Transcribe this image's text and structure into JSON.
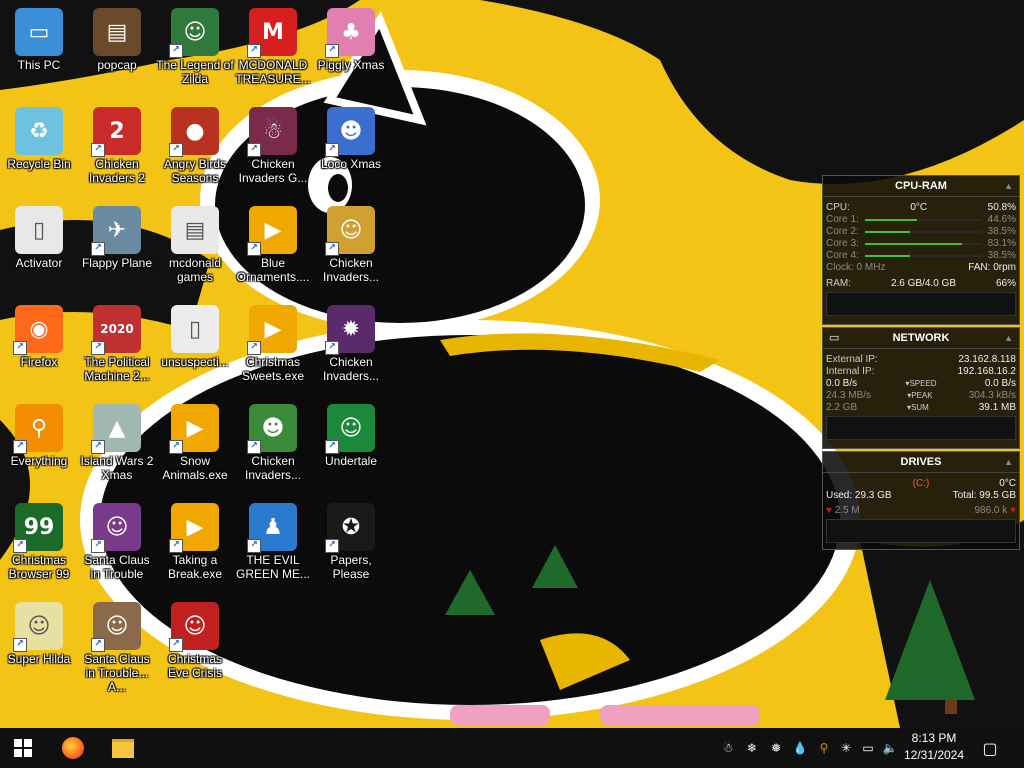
{
  "desktop": {
    "icons": [
      {
        "label": "This PC",
        "icon": "computer-icon",
        "color": "#3a8fd8",
        "glyph": "▭",
        "shortcut": false
      },
      {
        "label": "popcap",
        "icon": "folder-icon",
        "color": "#6b4a2a",
        "glyph": "▤",
        "shortcut": false
      },
      {
        "label": "The Legend of Zilda",
        "icon": "game-zilda-icon",
        "color": "#2f7a3a",
        "glyph": "☺",
        "shortcut": true
      },
      {
        "label": "MCDONALD TREASURE...",
        "icon": "mcdonalds-icon",
        "color": "#d71f1f",
        "glyph": "M",
        "shortcut": true
      },
      {
        "label": "Piggly Xmas",
        "icon": "piggly-icon",
        "color": "#e07fb0",
        "glyph": "♣",
        "shortcut": true
      },
      {
        "label": "Recycle Bin",
        "icon": "recycle-bin-icon",
        "color": "#6fc1e0",
        "glyph": "♻",
        "shortcut": false
      },
      {
        "label": "Chicken Invaders 2",
        "icon": "chicken-invaders-icon",
        "color": "#c92a2a",
        "glyph": "2",
        "shortcut": true
      },
      {
        "label": "Angry Birds Seasons",
        "icon": "angry-birds-icon",
        "color": "#b8321f",
        "glyph": "●",
        "shortcut": true
      },
      {
        "label": "Chicken Invaders G...",
        "icon": "chicken-invaders-icon",
        "color": "#7a2a4a",
        "glyph": "☃",
        "shortcut": true
      },
      {
        "label": "Loco Xmas",
        "icon": "loco-icon",
        "color": "#3a6fd0",
        "glyph": "☻",
        "shortcut": true
      },
      {
        "label": "Activator",
        "icon": "file-icon",
        "color": "#e8e8e8",
        "glyph": "▯",
        "shortcut": false
      },
      {
        "label": "Flappy Plane",
        "icon": "flappy-icon",
        "color": "#6a8aa0",
        "glyph": "✈",
        "shortcut": true
      },
      {
        "label": "mcdonald games",
        "icon": "folder-icon",
        "color": "#e9e9e9",
        "glyph": "▤",
        "shortcut": false
      },
      {
        "label": "Blue Ornaments....",
        "icon": "exe-icon",
        "color": "#f0a800",
        "glyph": "▶",
        "shortcut": true
      },
      {
        "label": "Chicken Invaders...",
        "icon": "chicken-invaders-icon",
        "color": "#d0a030",
        "glyph": "☺",
        "shortcut": true
      },
      {
        "label": "Firefox",
        "icon": "firefox-icon",
        "color": "#ff6a1a",
        "glyph": "◉",
        "shortcut": true
      },
      {
        "label": "The Political Machine 2...",
        "icon": "political-icon",
        "color": "#c03030",
        "glyph": "2020",
        "shortcut": true
      },
      {
        "label": "unsuspecti...",
        "icon": "file-icon",
        "color": "#ececec",
        "glyph": "▯",
        "shortcut": false
      },
      {
        "label": "Christmas Sweets.exe",
        "icon": "exe-icon",
        "color": "#f0a800",
        "glyph": "▶",
        "shortcut": true
      },
      {
        "label": "Chicken Invaders...",
        "icon": "chicken-invaders-icon",
        "color": "#5a2a6a",
        "glyph": "✹",
        "shortcut": true
      },
      {
        "label": "Everything",
        "icon": "search-icon",
        "color": "#f28c00",
        "glyph": "⚲",
        "shortcut": true
      },
      {
        "label": "Island Wars 2 Xmas",
        "icon": "island-icon",
        "color": "#a0b8b0",
        "glyph": "▲",
        "shortcut": true
      },
      {
        "label": "Snow Animals.exe",
        "icon": "exe-icon",
        "color": "#f0a800",
        "glyph": "▶",
        "shortcut": true
      },
      {
        "label": "Chicken Invaders...",
        "icon": "chicken-invaders-icon",
        "color": "#3a8a3a",
        "glyph": "☻",
        "shortcut": true
      },
      {
        "label": "Undertale",
        "icon": "undertale-icon",
        "color": "#1a8a3a",
        "glyph": "☺",
        "shortcut": true
      },
      {
        "label": "Christmas Browser 99",
        "icon": "xmas-browser-icon",
        "color": "#1a6a2a",
        "glyph": "99",
        "shortcut": true
      },
      {
        "label": "Santa Claus in Trouble",
        "icon": "santa-icon",
        "color": "#7a3a8a",
        "glyph": "☺",
        "shortcut": true
      },
      {
        "label": "Taking a Break.exe",
        "icon": "exe-icon",
        "color": "#f0a800",
        "glyph": "▶",
        "shortcut": true
      },
      {
        "label": "THE EVIL GREEN ME...",
        "icon": "messenger-icon",
        "color": "#2a7ad0",
        "glyph": "♟",
        "shortcut": true
      },
      {
        "label": "Papers, Please",
        "icon": "papers-please-icon",
        "color": "#1a1a1a",
        "glyph": "✪",
        "shortcut": true
      },
      {
        "label": "Super Hilda",
        "icon": "super-hilda-icon",
        "color": "#e8e0a0",
        "glyph": "☺",
        "shortcut": true
      },
      {
        "label": "Santa Claus in Trouble... A...",
        "icon": "santa-icon",
        "color": "#8a6a4a",
        "glyph": "☺",
        "shortcut": true
      },
      {
        "label": "Christmas Eve Crisis",
        "icon": "santa-icon",
        "color": "#c02020",
        "glyph": "☺",
        "shortcut": true
      }
    ]
  },
  "gadgets": {
    "cpu_ram": {
      "title": "CPU-RAM",
      "cpu_label": "CPU:",
      "cpu_temp": "0°C",
      "cpu_value": "50.8%",
      "cores": [
        {
          "label": "Core 1:",
          "value": "44.6%",
          "pct": 44.6
        },
        {
          "label": "Core 2:",
          "value": "38.5%",
          "pct": 38.5
        },
        {
          "label": "Core 3:",
          "value": "83.1%",
          "pct": 83.1
        },
        {
          "label": "Core 4:",
          "value": "38.5%",
          "pct": 38.5
        }
      ],
      "clock": "Clock: 0 MHz",
      "fan": "FAN: 0rpm",
      "ram_label": "RAM:",
      "ram_value": "2.6 GB/4.0 GB",
      "ram_pct": "66%"
    },
    "network": {
      "title": "NETWORK",
      "external_label": "External IP:",
      "external_ip": "23.162.8.118",
      "internal_label": "Internal IP:",
      "internal_ip": "192.168.16.2",
      "speed_left": "0.0 B/s",
      "speed_label": "SPEED",
      "speed_right": "0.0 B/s",
      "peak_left": "24.3 MB/s",
      "peak_label": "PEAK",
      "peak_right": "304.3 kB/s",
      "sum_left": "2.2 GB",
      "sum_label": "SUM",
      "sum_right": "39.1 MB"
    },
    "drives": {
      "title": "DRIVES",
      "drive": "(C:)",
      "temp": "0°C",
      "used": "Used: 29.3 GB",
      "total": "Total: 99.5 GB",
      "read": "2.5 M",
      "write": "986.0 k"
    }
  },
  "taskbar": {
    "time": "8:13 PM",
    "date": "12/31/2024"
  },
  "colors": {
    "wallpaper_yellow": "#f3c316",
    "taskbar": "#101010"
  }
}
